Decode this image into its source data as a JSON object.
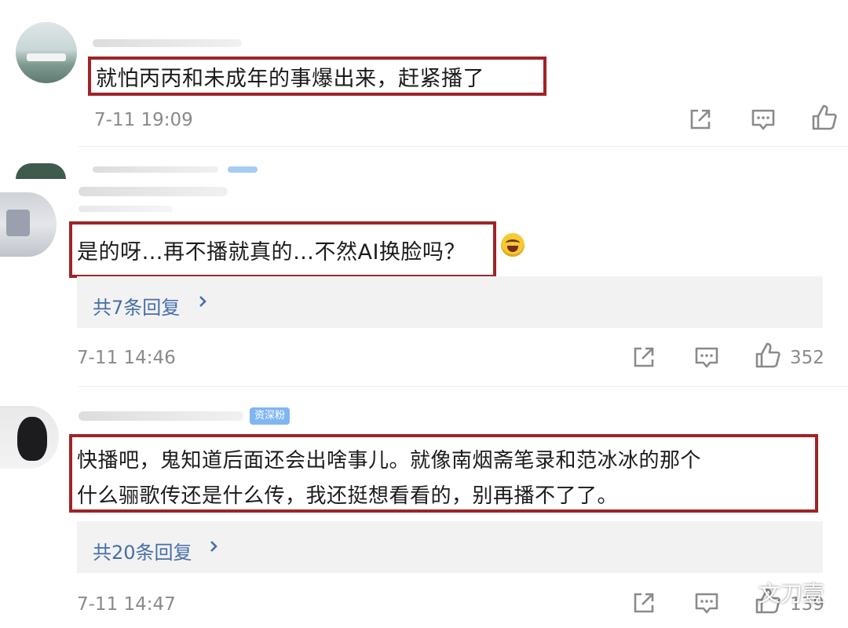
{
  "comments": [
    {
      "text": "就怕丙丙和未成年的事爆出来，赶紧播了",
      "time": "7-11 19:09",
      "like_count": ""
    },
    {
      "text": "是的呀…再不播就真的…不然AI换脸吗？",
      "reply_label": "共7条回复",
      "time": "7-11 14:46",
      "like_count": "352"
    },
    {
      "badge": "资深粉",
      "text_line1": "快播吧，鬼知道后面还会出啥事儿。就像南烟斋笔录和范冰冰的那个",
      "text_line2": "什么骊歌传还是什么传，我还挺想看看的，别再播不了了。",
      "reply_label": "共20条回复",
      "time": "7-11 14:47",
      "like_count": "139"
    }
  ],
  "icons": {
    "share": "share-icon",
    "comment": "comment-icon",
    "like": "thumbs-up-icon",
    "chevron": "chevron-right-icon",
    "emoji": "laughing-emoji-icon"
  },
  "watermark": "文刀壹",
  "colors": {
    "highlight_box": "#9e2428",
    "reply_link": "#466ea8",
    "meta_text": "#8a8a8a",
    "badge": "#7fb6f2"
  }
}
